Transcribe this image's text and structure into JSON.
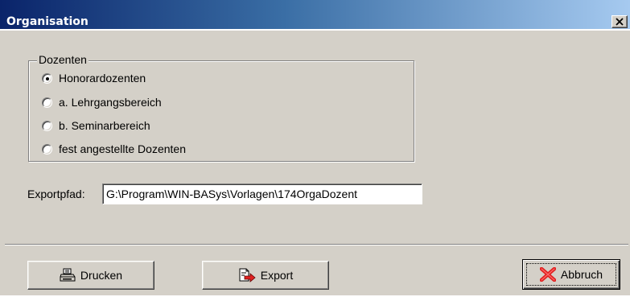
{
  "window": {
    "title": "Organisation",
    "close_glyph": "✕"
  },
  "dozenten": {
    "legend": "Dozenten",
    "options": [
      {
        "label": "Honorardozenten",
        "checked": true
      },
      {
        "label": "a. Lehrgangsbereich",
        "checked": false
      },
      {
        "label": "b. Seminarbereich",
        "checked": false
      },
      {
        "label": "fest angestellte Dozenten",
        "checked": false
      }
    ]
  },
  "export": {
    "label": "Exportpfad:",
    "value": "G:\\Program\\WIN-BASys\\Vorlagen\\174OrgaDozent"
  },
  "buttons": {
    "print_label": "Drucken",
    "export_label": "Export",
    "cancel_label": "Abbruch"
  },
  "icons": {
    "print": "printer-icon",
    "export": "export-arrow-icon",
    "cancel": "red-x-icon"
  },
  "colors": {
    "title_start": "#0a246a",
    "title_end": "#a6caf0",
    "face": "#d4d0c8",
    "cancel_x": "#e02020",
    "export_arrow": "#e02020"
  }
}
